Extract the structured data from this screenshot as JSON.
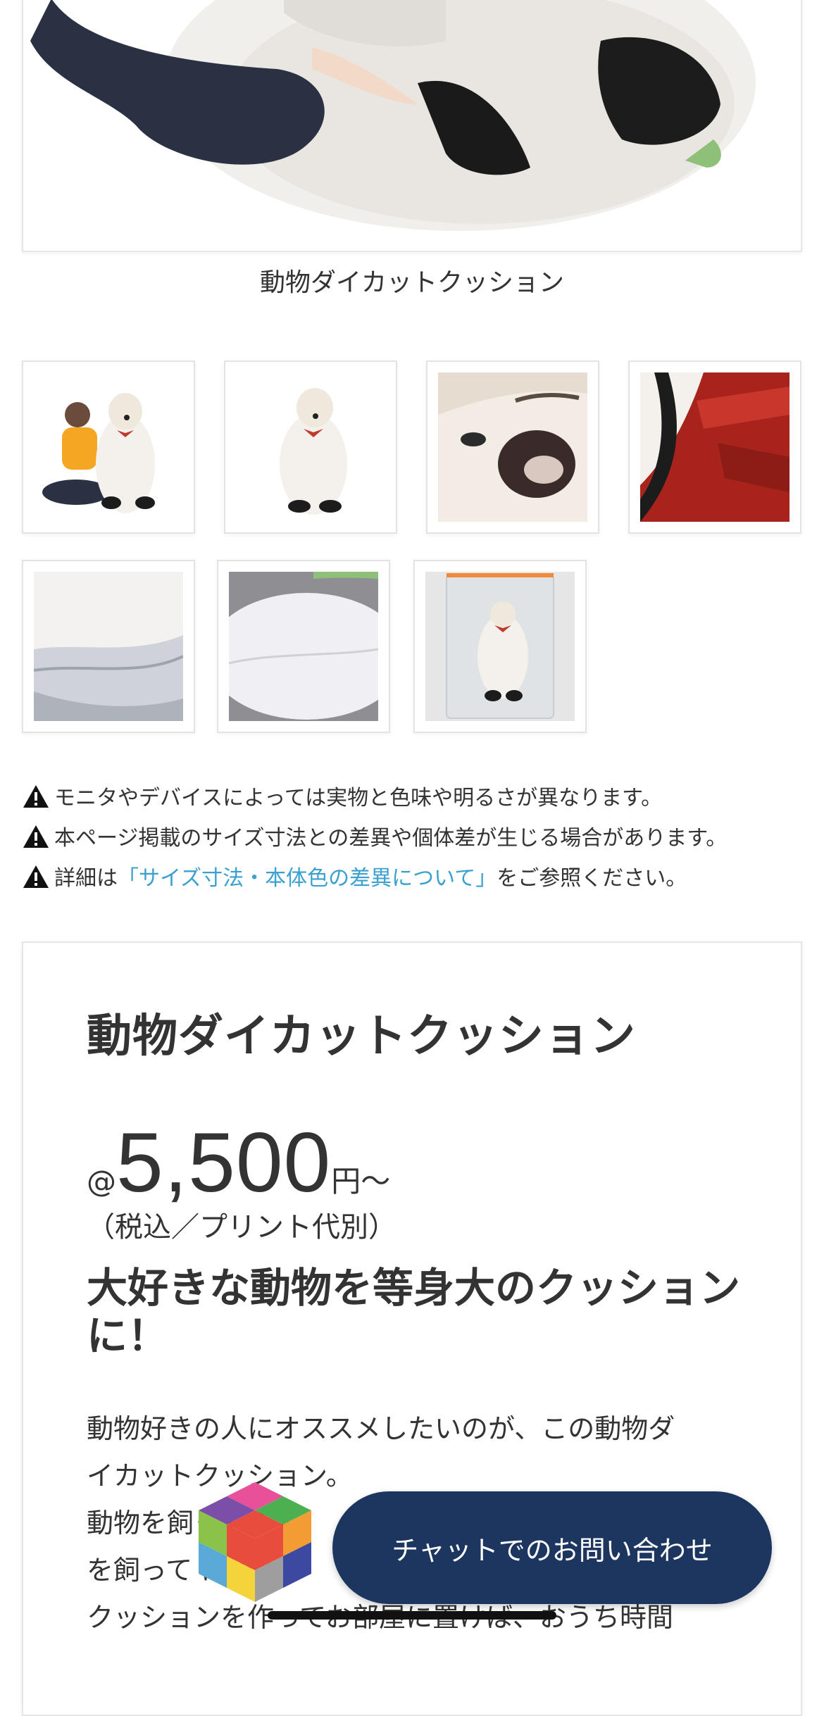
{
  "main_image": {
    "caption": "動物ダイカットクッション"
  },
  "thumbnails": [
    {
      "subject": "person-with-dog-cushion"
    },
    {
      "subject": "dog-cushion-front"
    },
    {
      "subject": "dog-face-closeup"
    },
    {
      "subject": "red-bow-closeup"
    },
    {
      "subject": "cushion-edge-grey"
    },
    {
      "subject": "cushion-back-white"
    },
    {
      "subject": "packaged-cushion"
    }
  ],
  "notices": [
    {
      "text": "モニタやデバイスによっては実物と色味や明るさが異なります。"
    },
    {
      "text": "本ページ掲載のサイズ寸法との差異や個体差が生じる場合があります。"
    },
    {
      "prefix": "詳細は",
      "link": "「サイズ寸法・本体色の差異について」",
      "suffix": "をご参照ください。"
    }
  ],
  "product": {
    "title": "動物ダイカットクッション",
    "price_at": "@",
    "price": "5,500",
    "price_unit": "円〜",
    "price_note": "（税込／プリント代別）",
    "headline": "大好きな動物を等身大のクッションに！",
    "body_lines": [
      "動物好きの人にオススメしたいのが、この動物ダ",
      "イカットクッション。",
      "動物を飼ってる人",
      "を飼って は憧",
      "クッションを作ってお部屋に置けば、おうち時間"
    ]
  },
  "chat": {
    "label": "チャットでのお問い合わせ"
  },
  "colors": {
    "link": "#3aa0d0",
    "chat_bg": "#1d3660",
    "text": "#333333",
    "border": "#e6e6e6"
  }
}
